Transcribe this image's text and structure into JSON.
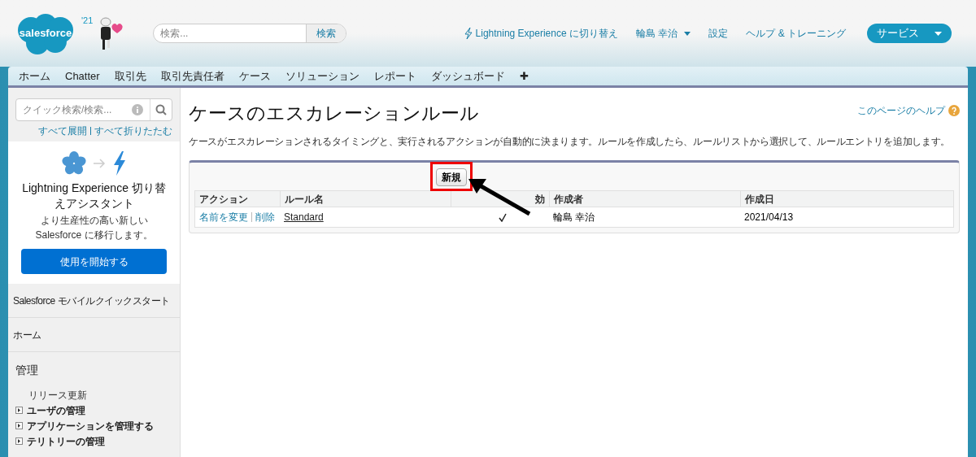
{
  "header": {
    "logo": "salesforce",
    "mascot_year": "'21",
    "search": {
      "placeholder": "検索...",
      "button": "検索"
    },
    "links": [
      {
        "kind": "lightning",
        "label": "Lightning Experience に切り替え"
      },
      {
        "kind": "menu",
        "label": "輪島 幸治"
      },
      {
        "kind": "plain",
        "label": "設定"
      },
      {
        "kind": "plain",
        "label": "ヘルプ & トレーニング"
      }
    ],
    "app_menu": "サービス"
  },
  "tabs": [
    {
      "label": "ホーム",
      "selected": false
    },
    {
      "label": "Chatter",
      "selected": false
    },
    {
      "label": "取引先",
      "selected": false
    },
    {
      "label": "取引先責任者",
      "selected": false
    },
    {
      "label": "ケース",
      "selected": false
    },
    {
      "label": "ソリューション",
      "selected": false
    },
    {
      "label": "レポート",
      "selected": false
    },
    {
      "label": "ダッシュボード",
      "selected": false
    },
    {
      "label": "✚",
      "selected": false
    }
  ],
  "sidebar": {
    "quick_search": {
      "placeholder": "クイック検索/検索..."
    },
    "expand_all": "すべて展開",
    "collapse_all": "すべて折りたたむ",
    "promo": {
      "title": "Lightning Experience 切り替えアシスタント",
      "text": "より生産性の高い新しい Salesforce に移行します。",
      "button": "使用を開始する"
    },
    "sections": [
      "Salesforce モバイルクイックスタート",
      "ホーム"
    ],
    "admin": {
      "title": "管理",
      "items": [
        {
          "kind": "link",
          "label": "リリース更新"
        },
        {
          "kind": "folder",
          "label": "ユーザの管理"
        },
        {
          "kind": "folder",
          "label": "アプリケーションを管理する"
        },
        {
          "kind": "folder",
          "label": "テリトリーの管理"
        }
      ]
    }
  },
  "page": {
    "title": "ケースのエスカレーションルール",
    "help": "このページのヘルプ",
    "description": "ケースがエスカレーションされるタイミングと、実行されるアクションが自動的に決まります。ルールを作成したら、ルールリストから選択して、ルールエントリを追加します。",
    "new_button": "新規",
    "table": {
      "columns": [
        "アクション",
        "ルール名",
        "効",
        "作成者",
        "作成日"
      ],
      "rows": [
        {
          "actions": [
            "名前を変更",
            "削除"
          ],
          "name": "Standard",
          "active": true,
          "creator": "輪島 幸治",
          "created": "2021/04/13"
        }
      ]
    }
  }
}
